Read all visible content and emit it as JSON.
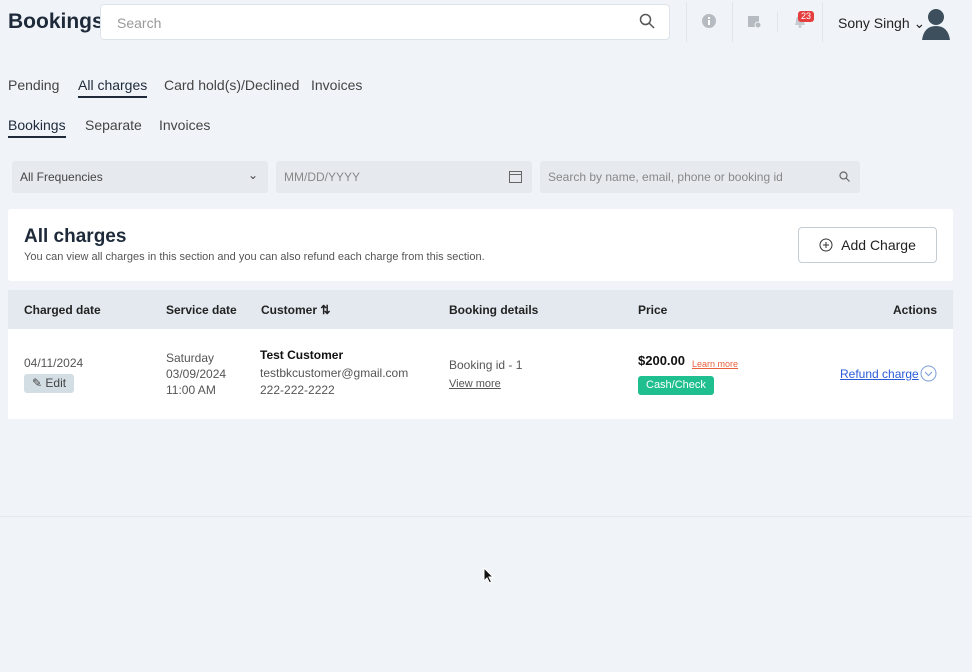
{
  "header": {
    "title": "Bookings",
    "search_placeholder": "Search",
    "notification_count": "23",
    "user_name": "Sony Singh"
  },
  "tabs": [
    "Pending",
    "All charges",
    "Card hold(s)/Declined",
    "Invoices"
  ],
  "subtabs": [
    "Bookings",
    "Separate",
    "Invoices"
  ],
  "filters": {
    "frequency": "All Frequencies",
    "date_placeholder": "MM/DD/YYYY",
    "search_placeholder": "Search by name, email, phone or booking id"
  },
  "section": {
    "title": "All charges",
    "description": "You can view all charges in this section and you can also refund each charge from this section.",
    "add_button": "Add Charge"
  },
  "table": {
    "columns": [
      "Charged date",
      "Service date",
      "Customer",
      "Booking details",
      "Price",
      "Actions"
    ],
    "rows": [
      {
        "charged_date": "04/11/2024",
        "edit": "Edit",
        "service_day": "Saturday",
        "service_date": "03/09/2024",
        "service_time": "11:00 AM",
        "customer_name": "Test Customer",
        "customer_email": "testbkcustomer@gmail.com",
        "customer_phone": "222-222-2222",
        "booking_id": "Booking id - 1",
        "view_more": "View more",
        "price": "$200.00",
        "learn_more": "Learn more",
        "payment_method": "Cash/Check",
        "refund": "Refund charge"
      }
    ]
  },
  "colors": {
    "accent": "#2a5bd7",
    "badge": "#1fbf8f",
    "learn": "#e8603c"
  }
}
